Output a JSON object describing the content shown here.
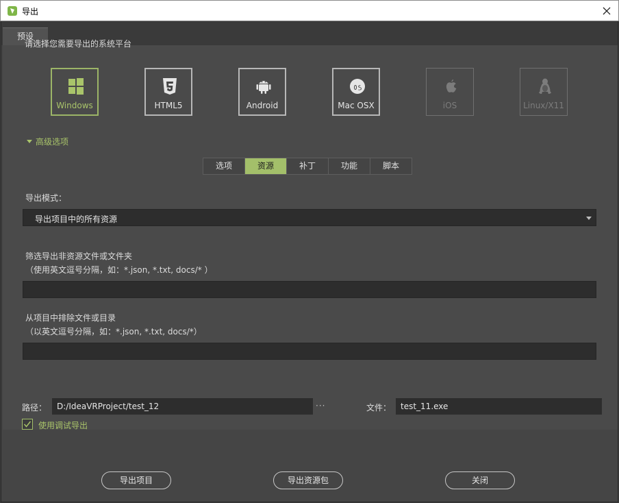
{
  "window": {
    "title": "导出"
  },
  "tabs": {
    "preset": "预设"
  },
  "prompt": "请选择您需要导出的系统平台",
  "platforms": [
    {
      "label": "Windows",
      "icon": "windows-icon",
      "state": "active"
    },
    {
      "label": "HTML5",
      "icon": "html5-icon",
      "state": "normal"
    },
    {
      "label": "Android",
      "icon": "android-icon",
      "state": "normal"
    },
    {
      "label": "Mac OSX",
      "icon": "macos-icon",
      "state": "normal"
    },
    {
      "label": "iOS",
      "icon": "apple-icon",
      "state": "disabled"
    },
    {
      "label": "Linux/X11",
      "icon": "linux-icon",
      "state": "disabled"
    }
  ],
  "advanced": {
    "label": "高级选项"
  },
  "subtabs": [
    {
      "label": "选项"
    },
    {
      "label": "资源",
      "active": true
    },
    {
      "label": "补丁"
    },
    {
      "label": "功能"
    },
    {
      "label": "脚本"
    }
  ],
  "export_mode": {
    "label": "导出模式：",
    "value": "导出项目中的所有资源"
  },
  "filter": {
    "label": "筛选导出非资源文件或文件夹",
    "hint": "（使用英文逗号分隔，如：*.json, *.txt, docs/* ）",
    "value": ""
  },
  "exclude": {
    "label": "从项目中排除文件或目录",
    "hint": "（以英文逗号分隔，如：*.json, *.txt, docs/*）",
    "value": ""
  },
  "footer": {
    "path_label": "路径：",
    "path_value": "D:/IdeaVRProject/test_12",
    "browse": "···",
    "file_label": "文件：",
    "file_value": "test_11.exe",
    "debug_label": "使用调试导出",
    "debug_checked": true
  },
  "buttons": {
    "export_project": "导出项目",
    "export_pack": "导出资源包",
    "close": "关闭"
  },
  "colors": {
    "accent": "#a3bf6a",
    "background": "#4a4a4a",
    "input": "#2d2d2d"
  }
}
